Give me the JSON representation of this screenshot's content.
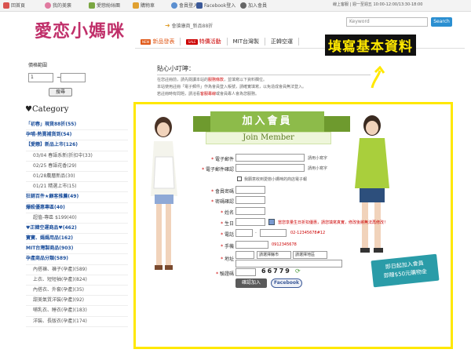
{
  "topbar": {
    "left_items": [
      {
        "label": "回首頁",
        "icon": "home-icon",
        "color": "#d9534f"
      },
      {
        "label": "我的美褒",
        "icon": "heart-icon",
        "color": "#e07aa0"
      },
      {
        "label": "愛戀紛絲團",
        "icon": "users-icon",
        "color": "#7aa642"
      },
      {
        "label": "購物車",
        "icon": "cart-icon",
        "color": "#e0a030"
      },
      {
        "label": "會員登入",
        "icon": "user-icon",
        "color": "#5b8fd0"
      },
      {
        "label": "Facebook登入",
        "icon": "facebook-icon",
        "color": "#3b5998"
      },
      {
        "label": "加入會員",
        "icon": "add-user-icon",
        "color": "#666666"
      }
    ],
    "service": "線上客服 | 週一至週五 10:00-12:00/13:30-18:00"
  },
  "logo": {
    "text": "愛恋小媽咪"
  },
  "promo": "會搶康商_新品88折",
  "search": {
    "placeholder": "Keyword",
    "button": "Search"
  },
  "nav": {
    "items": [
      {
        "label": "新品發表",
        "badge": "NEW"
      },
      {
        "label": "特價活動",
        "badge": "SALE"
      },
      {
        "label": "MIT台灣製",
        "badge": ""
      },
      {
        "label": "正韓空運",
        "badge": ""
      }
    ]
  },
  "annotation": "填寫基本資料",
  "sidebar": {
    "price_title": "價格範圍",
    "price_from": "1",
    "tilde": "~",
    "price_to": "",
    "query_button": "搜尋",
    "category_title": "♥Category",
    "categories": [
      {
        "label": "「初春」現貨88折(55)",
        "type": "main"
      },
      {
        "label": "孕哺-熱賣補貨到(54)",
        "type": "main"
      },
      {
        "label": "【愛戀】新品上市(126)",
        "type": "main"
      },
      {
        "label": "03/04 春語系新(折扣中(33)",
        "type": "sub"
      },
      {
        "label": "02/25 春語花香(29)",
        "type": "sub"
      },
      {
        "label": "01/28農曆新品(30)",
        "type": "sub"
      },
      {
        "label": "01/21 精選上市(15)",
        "type": "sub"
      },
      {
        "label": "狂銷百件★顧客推薦(49)",
        "type": "main"
      },
      {
        "label": "爆殺優惠專區(40)",
        "type": "main"
      },
      {
        "label": "超值-專區 $199(40)",
        "type": "sub"
      },
      {
        "label": "♥正韓空運商品♥(462)",
        "type": "main"
      },
      {
        "label": "寶寶、媽媽用品(162)",
        "type": "main"
      },
      {
        "label": "MIT台灣製商品(903)",
        "type": "main"
      },
      {
        "label": "孕產商品分類(589)",
        "type": "main"
      },
      {
        "label": "內搭褲、褲子(孕產)(589)",
        "type": "sub"
      },
      {
        "label": "上衣、短短袖(孕產)(824)",
        "type": "sub"
      },
      {
        "label": "內搭衣、外套(孕產)(35)",
        "type": "sub"
      },
      {
        "label": "甜美氣質洋裝(孕產)(92)",
        "type": "sub"
      },
      {
        "label": "哺乳衣、睡衣(孕產)(183)",
        "type": "sub"
      },
      {
        "label": "洋裝、長版衣(孕產)(174)",
        "type": "sub"
      }
    ]
  },
  "tips": {
    "title": "貼心小叮嚀：",
    "lines": [
      {
        "text": "在您註冊前，請先閱讀本站的",
        "link": "服務條款",
        "rest": "，並填寫以下資料欄位。"
      },
      {
        "text": "本站使用註冊「電子郵件」作為會員登入帳號，請確實填寫，以免造成會員無法登入。",
        "link": "",
        "rest": ""
      },
      {
        "text": "若註冊時有問題，請洽看",
        "link": "客服專線",
        "rest": "或會員專人會為您服務。"
      }
    ]
  },
  "form": {
    "header": "加入會員",
    "subheader": "Join Member",
    "email_label": "電子郵件",
    "email_hint": "請用小寫字",
    "email_confirm_label": "電子郵件確認",
    "email_confirm_hint": "請用小寫字",
    "newsletter_label": "我願意收到愛戀小媽咪的商店電子報",
    "password_label": "會員密碼",
    "password_confirm_label": "密碼確認",
    "name_label": "姓名",
    "birthday_label": "生日",
    "birthday_hint": "當您享量生日折扣優惠，請您填寫真實，修改後將無法再修改！",
    "phone_label": "電話",
    "phone_sep": "-",
    "phone_hint": "02-12345678#12",
    "mobile_label": "手機",
    "mobile_hint": "0912345678",
    "address_label": "地址",
    "city_placeholder": "請選擇縣市",
    "district_placeholder": "請選擇地區",
    "captcha_label": "驗證碼",
    "captcha_code": "66779",
    "submit": "確認加入",
    "facebook": "Facebook"
  },
  "bonus": {
    "line1": "即日起加入會員",
    "line2": "即贈$50元購物金"
  },
  "colors": {
    "accent_green": "#8dbb4a",
    "brand_pink": "#c0306a",
    "highlight": "#ffe800"
  }
}
